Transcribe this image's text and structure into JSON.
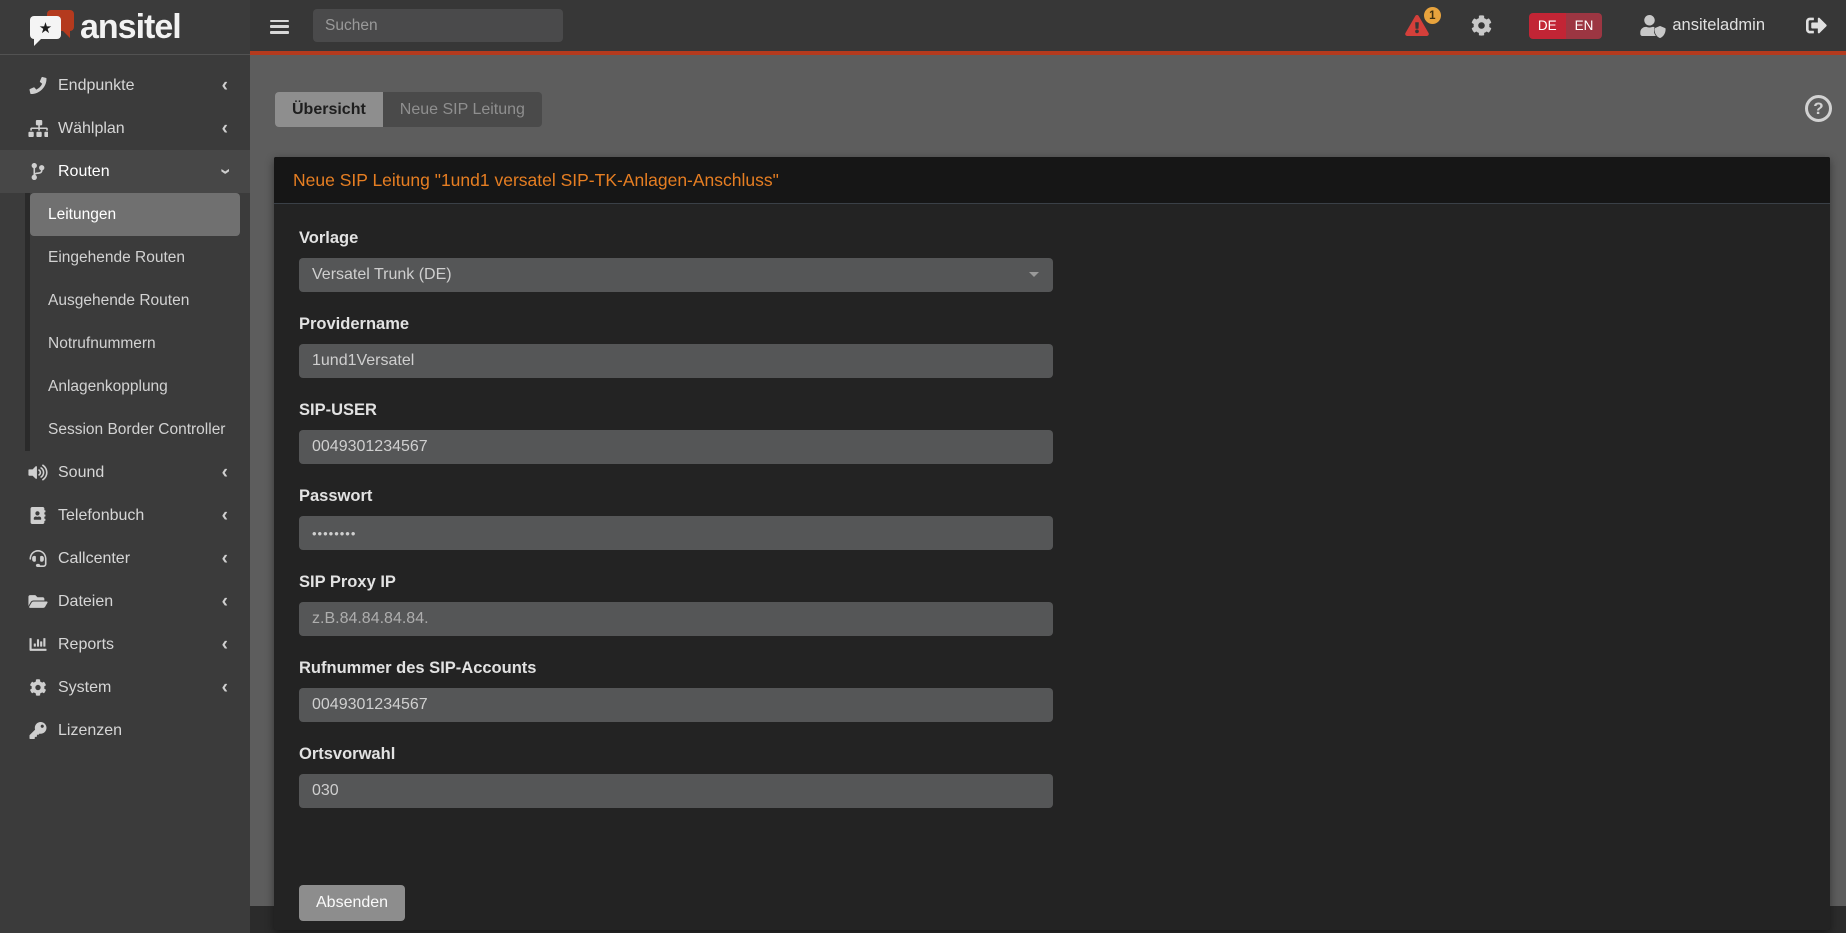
{
  "branding": {
    "logo_text": "ansitel",
    "logo_star": "★"
  },
  "topbar": {
    "search_placeholder": "Suchen",
    "alert_count": "1",
    "language": {
      "de": "DE",
      "en": "EN"
    },
    "username": "ansiteladmin"
  },
  "sidebar": {
    "items": [
      {
        "id": "endpunkte",
        "label": "Endpunkte",
        "icon": "phone-icon",
        "chevron": "left"
      },
      {
        "id": "waehlplan",
        "label": "Wählplan",
        "icon": "sitemap-icon",
        "chevron": "left"
      },
      {
        "id": "routen",
        "label": "Routen",
        "icon": "code-branch-icon",
        "chevron": "down",
        "expanded": true,
        "children": [
          {
            "label": "Leitungen",
            "active": true
          },
          {
            "label": "Eingehende Routen"
          },
          {
            "label": "Ausgehende Routen"
          },
          {
            "label": "Notrufnummern"
          },
          {
            "label": "Anlagenkopplung"
          },
          {
            "label": "Session Border Controller"
          }
        ]
      },
      {
        "id": "sound",
        "label": "Sound",
        "icon": "volume-up-icon",
        "chevron": "left"
      },
      {
        "id": "telefonbuch",
        "label": "Telefonbuch",
        "icon": "address-book-icon",
        "chevron": "left"
      },
      {
        "id": "callcenter",
        "label": "Callcenter",
        "icon": "headset-icon",
        "chevron": "left"
      },
      {
        "id": "dateien",
        "label": "Dateien",
        "icon": "folder-open-icon",
        "chevron": "left"
      },
      {
        "id": "reports",
        "label": "Reports",
        "icon": "chart-bar-icon",
        "chevron": "left"
      },
      {
        "id": "system",
        "label": "System",
        "icon": "cogs-icon",
        "chevron": "left"
      },
      {
        "id": "lizenzen",
        "label": "Lizenzen",
        "icon": "key-icon",
        "chevron": "none"
      }
    ]
  },
  "tabs": [
    {
      "label": "Übersicht",
      "active": true
    },
    {
      "label": "Neue SIP Leitung",
      "active": false
    }
  ],
  "help_glyph": "?",
  "panel": {
    "title": "Neue SIP Leitung \"1und1 versatel SIP-TK-Anlagen-Anschluss\""
  },
  "form": {
    "fields": [
      {
        "name": "vorlage",
        "label": "Vorlage",
        "type": "select",
        "value": "Versatel Trunk (DE)"
      },
      {
        "name": "providername",
        "label": "Providername",
        "type": "text",
        "value": "1und1Versatel"
      },
      {
        "name": "sip-user",
        "label": "SIP-USER",
        "type": "text",
        "value": "0049301234567"
      },
      {
        "name": "passwort",
        "label": "Passwort",
        "type": "password",
        "value": "••••••••"
      },
      {
        "name": "sip-proxy-ip",
        "label": "SIP Proxy IP",
        "type": "text",
        "value": "",
        "placeholder": "z.B.84.84.84.84."
      },
      {
        "name": "rufnummer-sip-account",
        "label": "Rufnummer des SIP-Accounts",
        "type": "text",
        "value": "0049301234567"
      },
      {
        "name": "ortsvorwahl",
        "label": "Ortsvorwahl",
        "type": "text",
        "value": "030"
      }
    ],
    "submit_label": "Absenden"
  },
  "colors": {
    "accent_red": "#b43a1e",
    "title_orange": "#e67e22",
    "badge_yellow": "#e8a33d",
    "alert_red": "#d43f3a",
    "lang_active": "#c22535",
    "lang_inactive": "#9c3642"
  }
}
